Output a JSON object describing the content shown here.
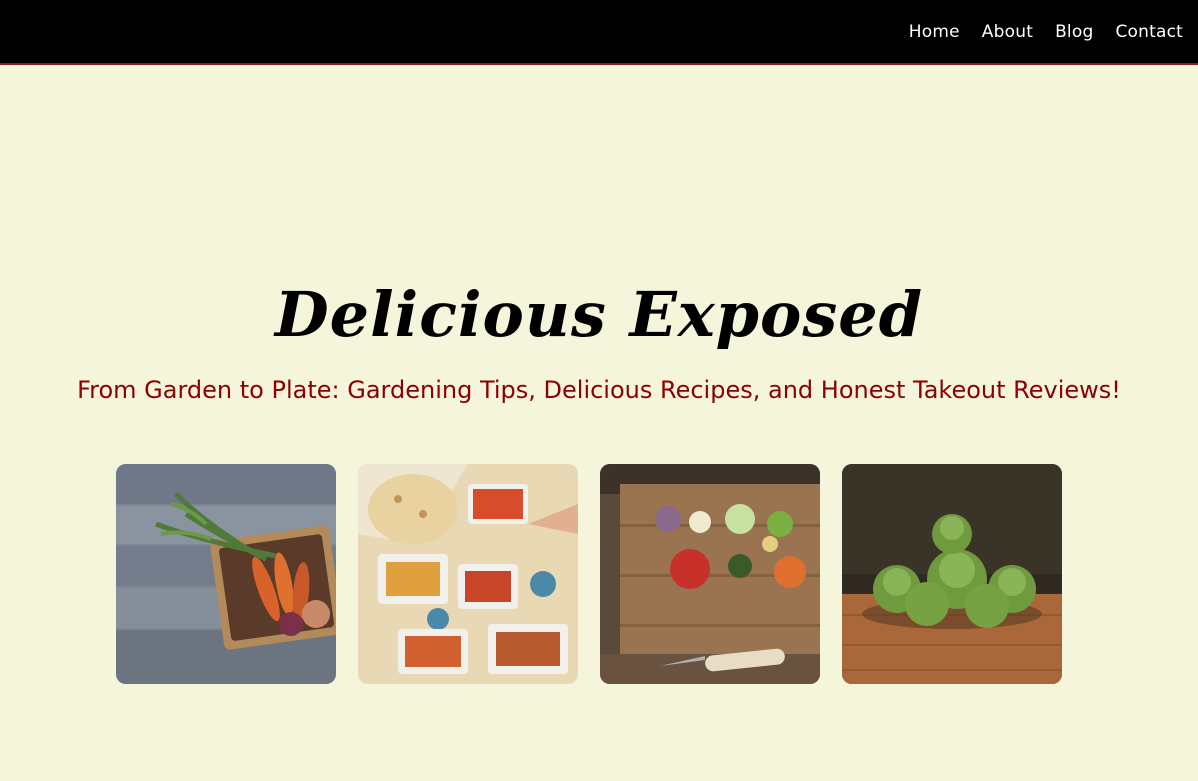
{
  "nav": {
    "links": [
      "Home",
      "About",
      "Blog",
      "Contact"
    ]
  },
  "hero": {
    "title": "Delicious Exposed",
    "tagline": "From Garden to Plate: Gardening Tips, Delicious Recipes, and Honest Takeout Reviews!"
  },
  "gallery": {
    "images": [
      {
        "subject": "basket of harvested carrots and vegetables on wooden planks"
      },
      {
        "subject": "table spread of takeout food and flatbread"
      },
      {
        "subject": "chopped vegetables on a cutting board with a knife"
      },
      {
        "subject": "brussels sprouts on a wooden table"
      }
    ]
  },
  "colors": {
    "background": "#f5f5dc",
    "navbar": "#000000",
    "nav_border": "#8b1a1a",
    "tagline": "#8b0000"
  }
}
